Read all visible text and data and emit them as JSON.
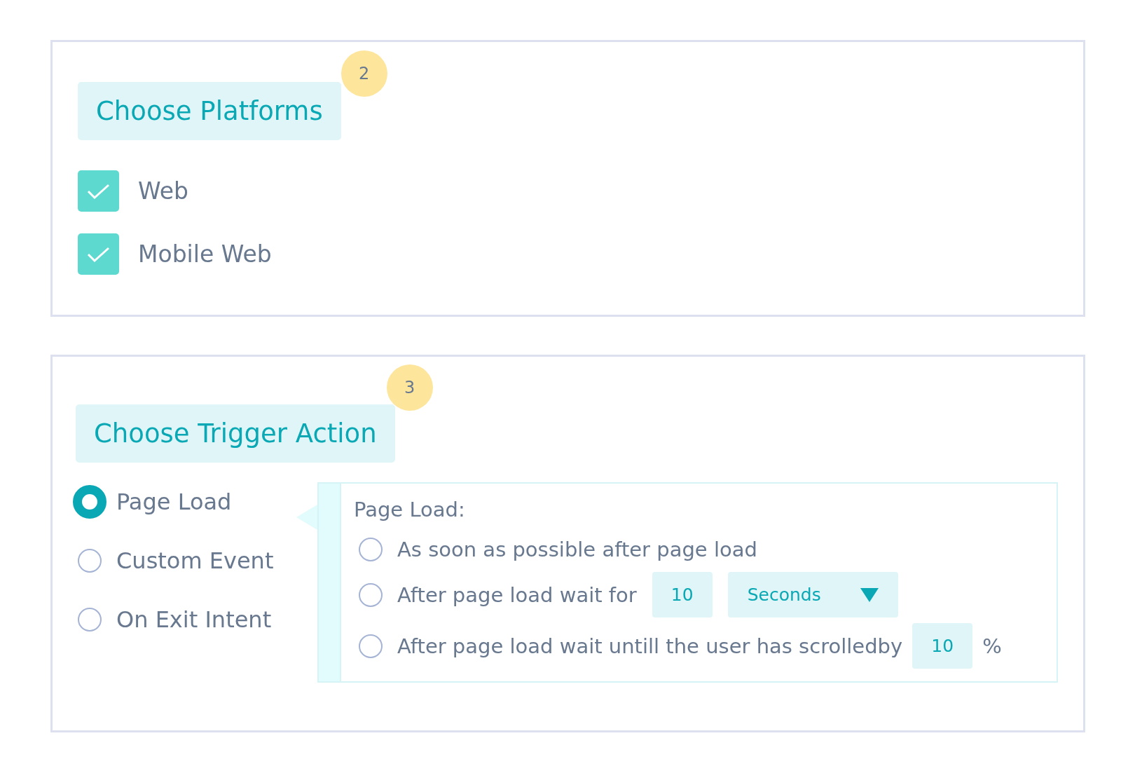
{
  "sections": [
    {
      "kind": "checkboxes",
      "title": "Choose Platforms",
      "step": "2",
      "options": [
        {
          "label": "Web",
          "checked": true
        },
        {
          "label": "Mobile Web",
          "checked": true
        }
      ]
    },
    {
      "kind": "trigger",
      "title": "Choose Trigger Action",
      "step": "3",
      "options": [
        {
          "label": "Page Load",
          "selected": true
        },
        {
          "label": "Custom Event",
          "selected": false
        },
        {
          "label": "On Exit Intent",
          "selected": false
        }
      ],
      "detail": {
        "title": "Page Load:",
        "options": [
          {
            "kind": "plain",
            "label": "As soon as possible after page load",
            "selected": false
          },
          {
            "kind": "delay",
            "label": "After page load wait for",
            "value": "10",
            "unit": "Seconds",
            "selected": false
          },
          {
            "kind": "scroll",
            "label": "After page load wait untill the user has scrolledby",
            "value": "10",
            "suffix": "%",
            "selected": false
          }
        ]
      }
    }
  ]
}
